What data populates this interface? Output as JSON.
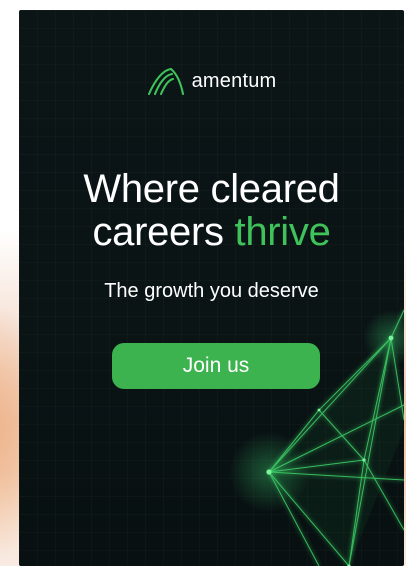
{
  "brand": {
    "name": "amentum",
    "logo_icon": "amentum-arch-logo-icon"
  },
  "headline": {
    "line1": "Where cleared",
    "line2_lead": "careers ",
    "line2_accent": "thrive"
  },
  "tagline": "The growth you deserve",
  "cta": {
    "label": "Join us"
  },
  "colors": {
    "background": "#0b1516",
    "accent": "#3fc25a",
    "button": "#3cb34e",
    "text": "#ffffff",
    "backdrop_glow": "#f0c6a8"
  },
  "decoration": {
    "graphic": "glowing-green-polygon-mesh"
  }
}
